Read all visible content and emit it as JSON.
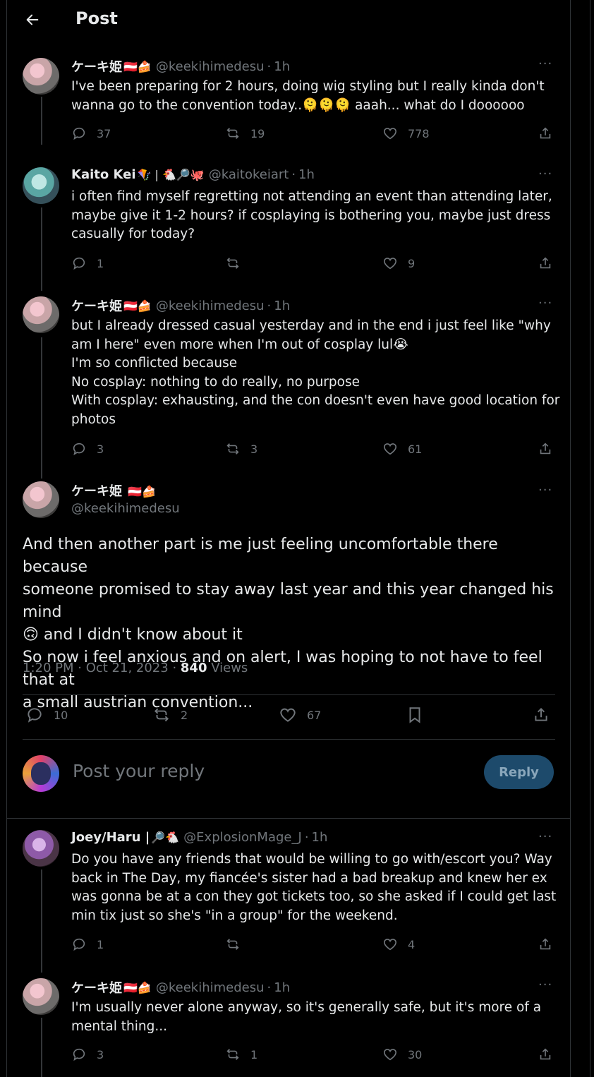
{
  "header": {
    "title": "Post"
  },
  "posts": [
    {
      "name": "ケーキ姫",
      "emoji": "🇦🇹🍰",
      "handle": "@keekihimedesu",
      "time": "1h",
      "text": "I've been preparing for 2 hours, doing wig styling but I really kinda don't\nwanna go to the convention today..🫠🫠🫠 aaah... what do I doooooo",
      "replies": "37",
      "reposts": "19",
      "likes": "778"
    },
    {
      "name": "Kaito Kei",
      "emoji": "🪁 | 🐔🔎🐙",
      "handle": "@kaitokeiart",
      "time": "1h",
      "text": "i often find myself regretting not attending an event than attending later,\nmaybe give it 1-2 hours? if cosplaying is bothering you, maybe just dress\ncasually for today?",
      "replies": "1",
      "reposts": "",
      "likes": "9"
    },
    {
      "name": "ケーキ姫",
      "emoji": "🇦🇹🍰",
      "handle": "@keekihimedesu",
      "time": "1h",
      "text": "but I already dressed casual yesterday and in the end i just feel like \"why\nam I here\" even more when I'm out of cosplay lul😭\nI'm so conflicted because\nNo cosplay: nothing to do really, no purpose\nWith cosplay: exhausting, and the con doesn't even have good location for\nphotos",
      "replies": "3",
      "reposts": "3",
      "likes": "61"
    }
  ],
  "main_post": {
    "name": "ケーキ姫",
    "emoji": "🇦🇹🍰",
    "handle": "@keekihimedesu",
    "text": "And then another part is me just feeling uncomfortable there because\nsomeone promised to stay away last year and this year changed his mind\n🙃 and I didn't know about it\nSo now i feel anxious and on alert, I was hoping to not have to feel that at\na small austrian convention...",
    "datetime": "1:20 PM · Oct 21, 2023",
    "views_count": "840",
    "views_label": "Views",
    "replies": "10",
    "reposts": "2",
    "likes": "67"
  },
  "reply_box": {
    "placeholder": "Post your reply",
    "button": "Reply"
  },
  "replies": [
    {
      "name": "Joey/Haru |",
      "emoji": "🔎🐔",
      "handle": "@ExplosionMage_J",
      "time": "1h",
      "text": "Do you have any friends that would be willing to go with/escort you? Way\nback in The Day, my fiancée's sister had a bad breakup and knew her ex\nwas gonna be at a con they got tickets too, so she asked if I could get last\nmin tix just so she's \"in a group\" for the weekend.",
      "replies": "1",
      "reposts": "",
      "likes": "4"
    },
    {
      "name": "ケーキ姫",
      "emoji": "🇦🇹🍰",
      "handle": "@keekihimedesu",
      "time": "1h",
      "text": "I'm usually never alone anyway, so it's generally safe, but it's more of a\nmental thing...",
      "replies": "3",
      "reposts": "1",
      "likes": "30"
    }
  ],
  "separator": "·",
  "more": "···",
  "icons": [
    "back-arrow-icon",
    "reply-icon",
    "repost-icon",
    "like-icon",
    "bookmark-icon",
    "share-icon",
    "more-icon"
  ],
  "colors": {
    "background": "#000000",
    "text": "#e7e9ea",
    "muted": "#71767b",
    "border": "#2f3336",
    "reply_button": "#1d4a6b"
  }
}
